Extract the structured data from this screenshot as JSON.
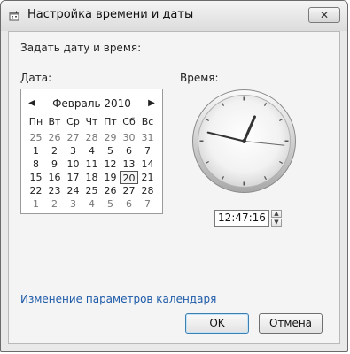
{
  "window": {
    "title": "Настройка времени и даты",
    "icon": "date-time-settings-icon",
    "close_icon": "close-icon"
  },
  "main": {
    "heading": "Задать дату и время:",
    "date_label": "Дата:",
    "time_label": "Время:"
  },
  "calendar": {
    "month_label": "Февраль 2010",
    "prev_icon": "chevron-left-icon",
    "next_icon": "chevron-right-icon",
    "weekdays": [
      "Пн",
      "Вт",
      "Ср",
      "Чт",
      "Пт",
      "Сб",
      "Вс"
    ],
    "weeks": [
      [
        "25",
        "26",
        "27",
        "28",
        "29",
        "30",
        "31"
      ],
      [
        "1",
        "2",
        "3",
        "4",
        "5",
        "6",
        "7"
      ],
      [
        "8",
        "9",
        "10",
        "11",
        "12",
        "13",
        "14"
      ],
      [
        "15",
        "16",
        "17",
        "18",
        "19",
        "20",
        "21"
      ],
      [
        "22",
        "23",
        "24",
        "25",
        "26",
        "27",
        "28"
      ],
      [
        "1",
        "2",
        "3",
        "4",
        "5",
        "6",
        "7"
      ]
    ],
    "selected_day": "20"
  },
  "time": {
    "value": "12:47:16",
    "hour": 12,
    "minute": 47,
    "second": 16,
    "spin_up_icon": "spin-up-icon",
    "spin_down_icon": "spin-down-icon"
  },
  "footer": {
    "calendar_settings_link": "Изменение параметров календаря",
    "ok_label": "OK",
    "cancel_label": "Отмена"
  },
  "colors": {
    "link": "#1d5aa8",
    "window_bg": "#f4f4f4",
    "default_button_border": "#3c7fb1"
  }
}
